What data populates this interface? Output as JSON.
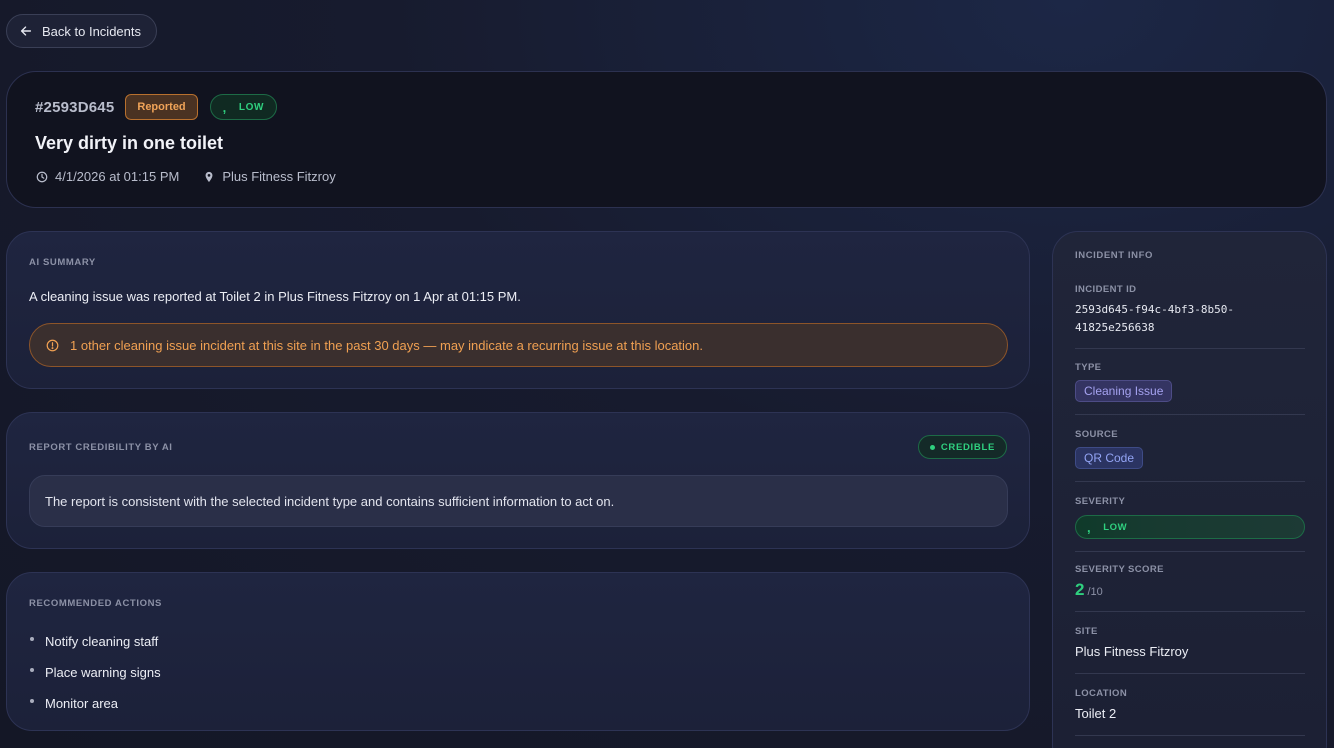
{
  "nav": {
    "back_label": "Back to Incidents"
  },
  "header": {
    "incident_number": "#2593D645",
    "status": "Reported",
    "severity_mark": ",",
    "severity": "LOW",
    "title": "Very dirty in one toilet",
    "datetime": "4/1/2026 at 01:15 PM",
    "site": "Plus Fitness Fitzroy"
  },
  "ai_summary": {
    "title": "AI SUMMARY",
    "text": "A cleaning issue was reported at Toilet 2 in Plus Fitness Fitzroy on 1 Apr at 01:15 PM.",
    "warning": "1 other cleaning issue incident at this site in the past 30 days — may indicate a recurring issue at this location."
  },
  "credibility": {
    "title": "REPORT CREDIBILITY BY AI",
    "badge": "CREDIBLE",
    "text": "The report is consistent with the selected incident type and contains sufficient information to act on."
  },
  "actions": {
    "title": "RECOMMENDED ACTIONS",
    "items": [
      "Notify cleaning staff",
      "Place warning signs",
      "Monitor area"
    ]
  },
  "info": {
    "title": "INCIDENT INFO",
    "id_label": "INCIDENT ID",
    "id_line1": "2593d645-f94c-4bf3-8b50-",
    "id_line2": "41825e256638",
    "type_label": "TYPE",
    "type": "Cleaning Issue",
    "source_label": "SOURCE",
    "source": "QR Code",
    "severity_label": "SEVERITY",
    "severity_mark": ",",
    "severity": "LOW",
    "score_label": "SEVERITY SCORE",
    "score": "2",
    "score_max": "/10",
    "site_label": "SITE",
    "site": "Plus Fitness Fitzroy",
    "location_label": "LOCATION",
    "location": "Toilet 2"
  },
  "colors": {
    "accent_green": "#2fd07f",
    "accent_orange": "#f0a358",
    "background": "#16192a"
  }
}
